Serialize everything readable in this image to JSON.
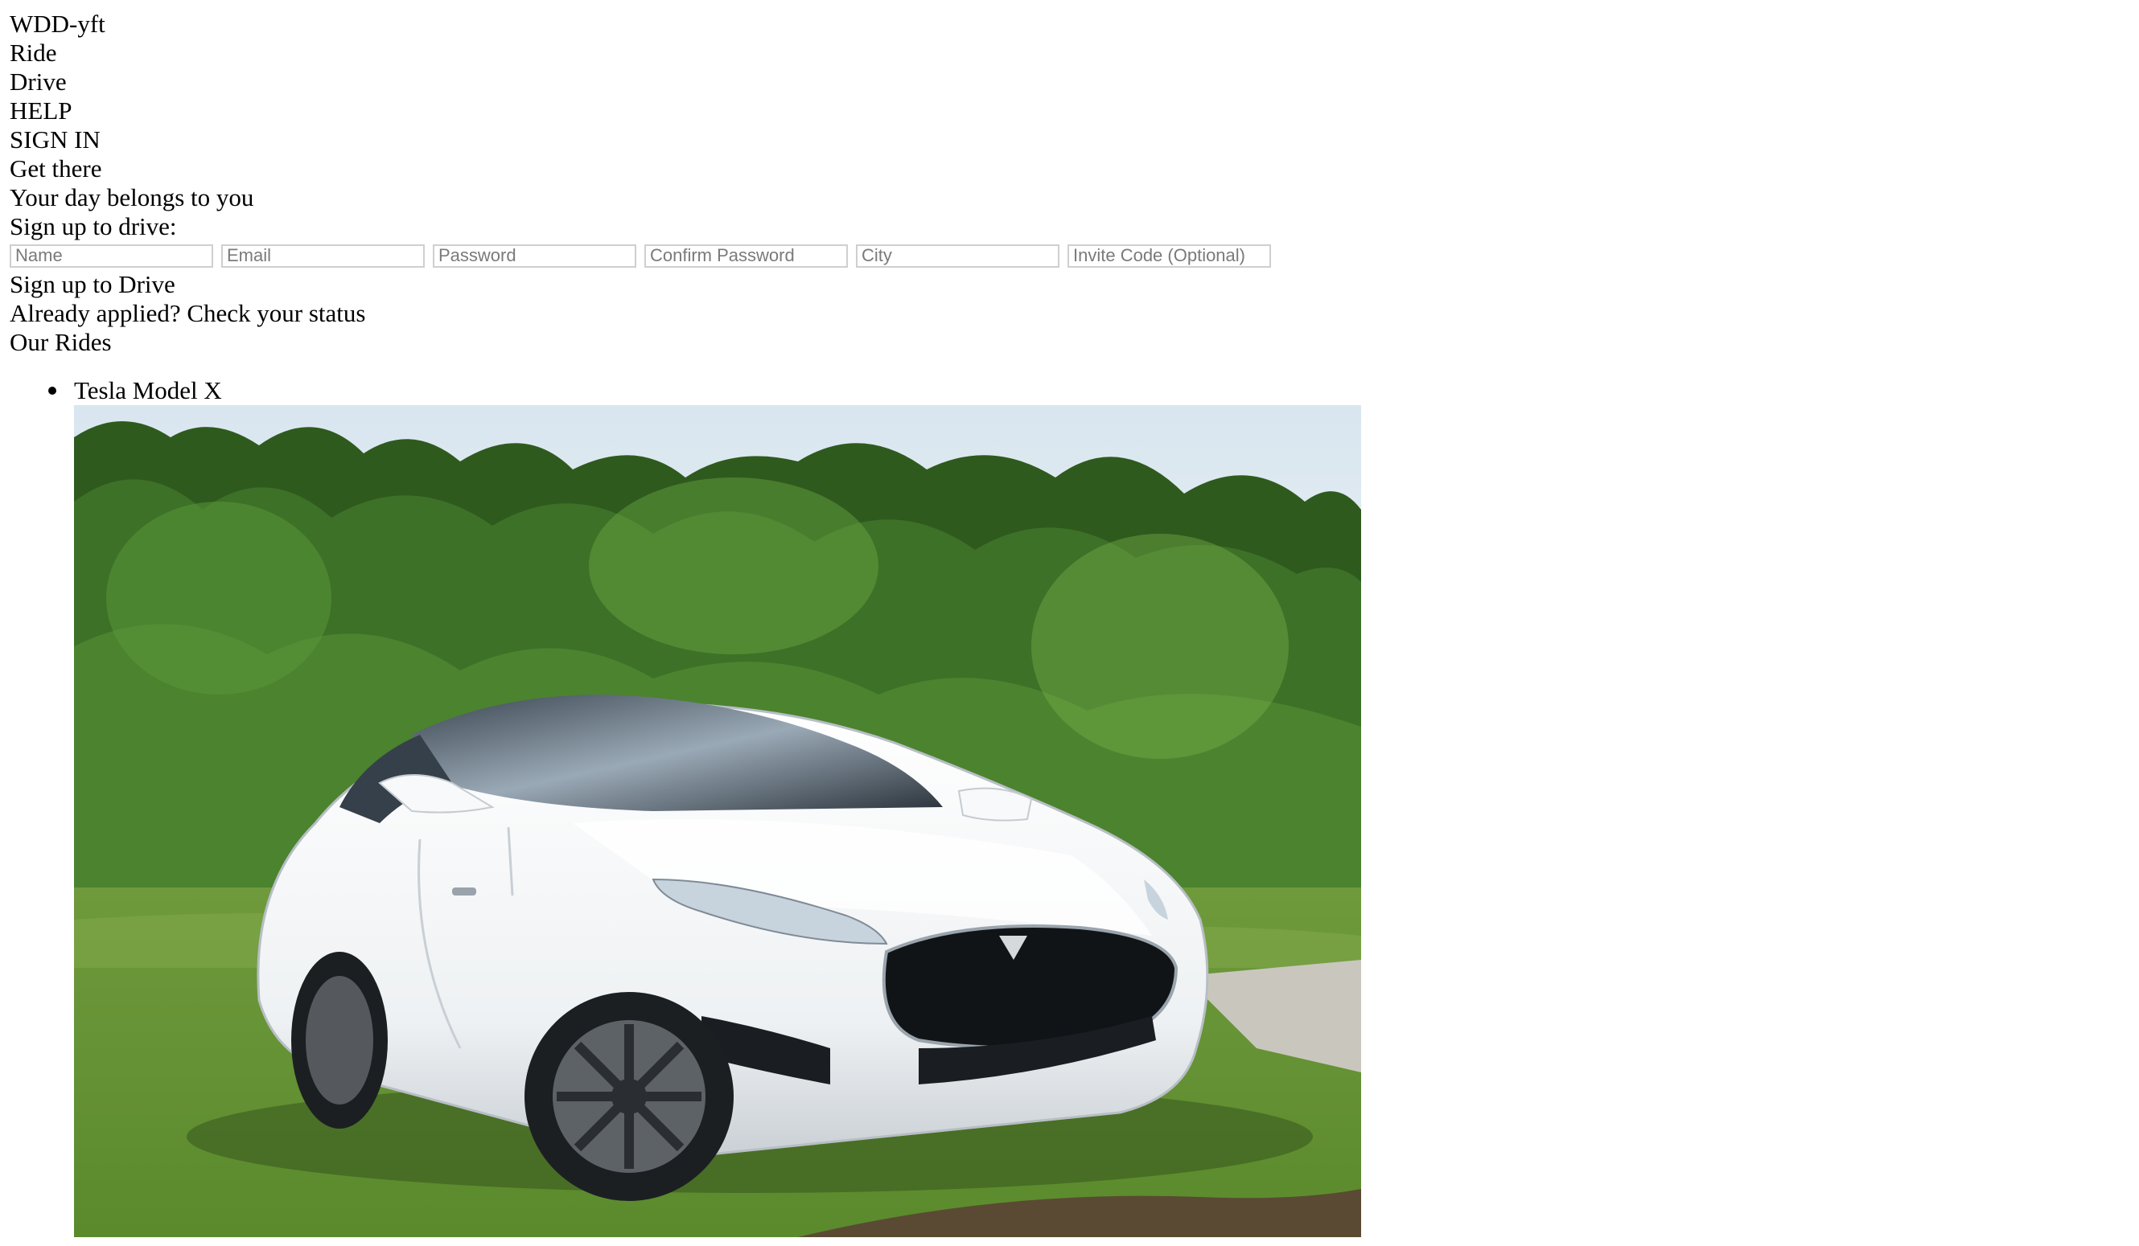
{
  "header": {
    "brand": "WDD-yft",
    "nav": [
      {
        "label": "Ride"
      },
      {
        "label": "Drive"
      },
      {
        "label": "HELP"
      },
      {
        "label": "SIGN IN"
      }
    ]
  },
  "hero": {
    "headline": "Get there",
    "subheadline": "Your day belongs to you"
  },
  "signup": {
    "prompt": "Sign up to drive:",
    "fields": {
      "name": {
        "value": "",
        "placeholder": "Name"
      },
      "email": {
        "value": "",
        "placeholder": "Email"
      },
      "password": {
        "value": "",
        "placeholder": "Password"
      },
      "confirm_password": {
        "value": "",
        "placeholder": "Confirm Password"
      },
      "city": {
        "value": "",
        "placeholder": "City"
      },
      "invite_code": {
        "value": "",
        "placeholder": "Invite Code (Optional)"
      }
    },
    "submit_label": "Sign up to Drive",
    "status_link": "Already applied? Check your status"
  },
  "rides": {
    "title": "Our Rides",
    "items": [
      {
        "name": "Tesla Model X",
        "image": "white-electric-sedan-on-grass-photo"
      }
    ]
  }
}
